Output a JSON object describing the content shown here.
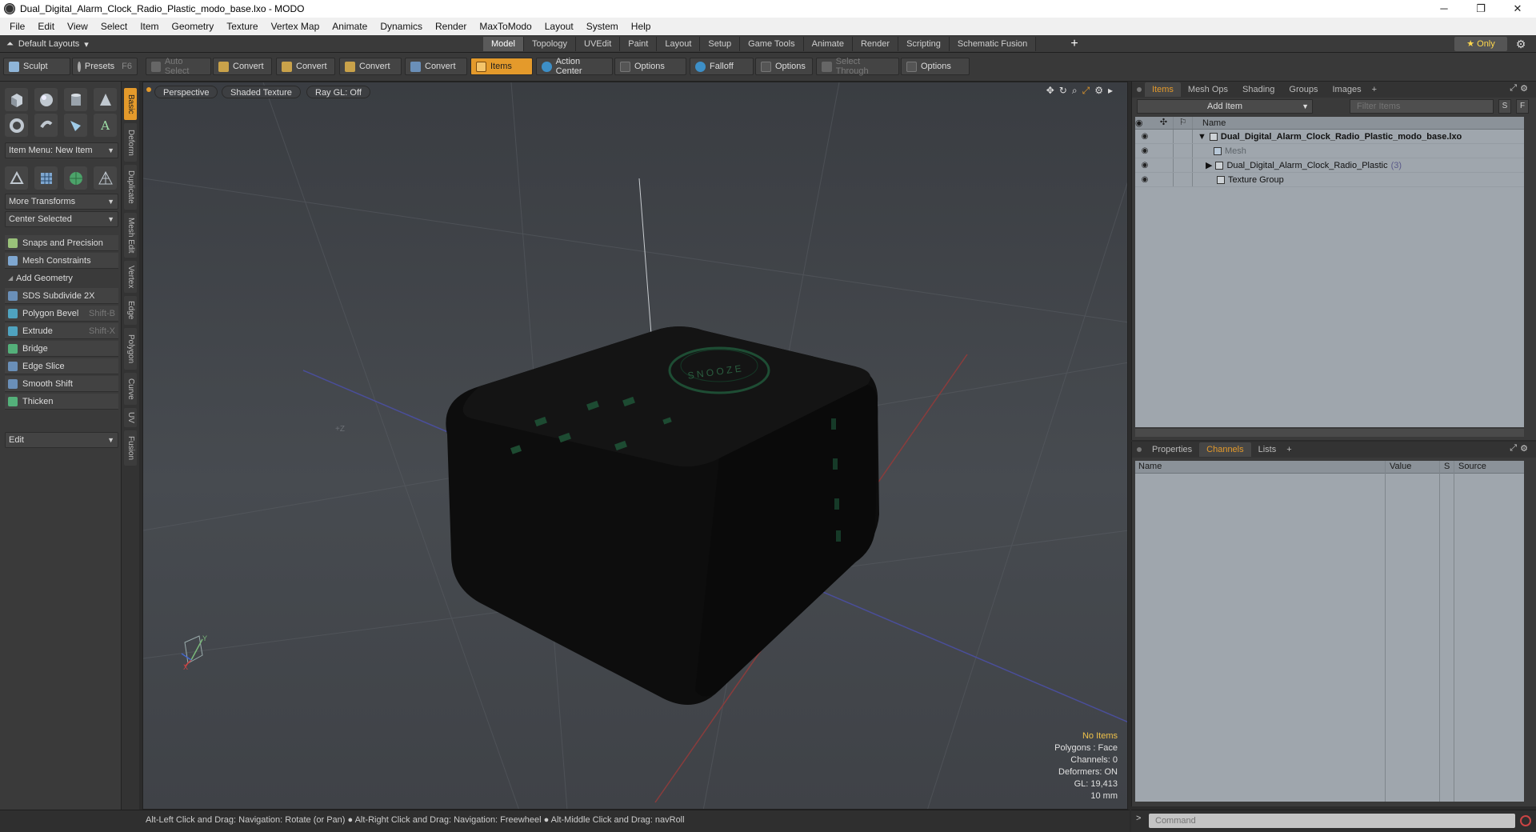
{
  "window": {
    "title": "Dual_Digital_Alarm_Clock_Radio_Plastic_modo_base.lxo - MODO",
    "controls": [
      "─",
      "❐",
      "✕"
    ]
  },
  "menu": [
    "File",
    "Edit",
    "View",
    "Select",
    "Item",
    "Geometry",
    "Texture",
    "Vertex Map",
    "Animate",
    "Dynamics",
    "Render",
    "MaxToModo",
    "Layout",
    "System",
    "Help"
  ],
  "layout_bar": {
    "layouts_label": "Default Layouts",
    "tabs": [
      "Model",
      "Topology",
      "UVEdit",
      "Paint",
      "Layout",
      "Setup",
      "Game Tools",
      "Animate",
      "Render",
      "Scripting",
      "Schematic Fusion"
    ],
    "active_tab": "Model",
    "add_label": "+",
    "only_label": "★  Only"
  },
  "toolbar": {
    "sculpt": "Sculpt",
    "presets": "Presets",
    "presets_key": "F6",
    "auto_select": "Auto Select",
    "convert1": "Convert",
    "convert2": "Convert",
    "convert3": "Convert",
    "convert4": "Convert",
    "items": "Items",
    "action_center": "Action Center",
    "options1": "Options",
    "falloff": "Falloff",
    "options2": "Options",
    "select_through": "Select Through",
    "options3": "Options"
  },
  "left_panel": {
    "item_menu": "Item Menu: New Item",
    "more_transforms": "More Transforms",
    "center_selected": "Center Selected",
    "snaps": "Snaps and Precision",
    "mesh_constraints": "Mesh Constraints",
    "add_geometry": "Add Geometry",
    "tools": [
      {
        "label": "SDS Subdivide 2X",
        "shortcut": "",
        "color": "#6a8fb8"
      },
      {
        "label": "Polygon Bevel",
        "shortcut": "Shift-B",
        "color": "#4fa3c0"
      },
      {
        "label": "Extrude",
        "shortcut": "Shift-X",
        "color": "#4fa3c0"
      },
      {
        "label": "Bridge",
        "shortcut": "",
        "color": "#54b07a"
      },
      {
        "label": "Edge Slice",
        "shortcut": "",
        "color": "#6a8fb8"
      },
      {
        "label": "Smooth Shift",
        "shortcut": "",
        "color": "#6a8fb8"
      },
      {
        "label": "Thicken",
        "shortcut": "",
        "color": "#54b07a"
      }
    ],
    "edit_drop": "Edit"
  },
  "vertical_tabs": [
    "Basic",
    "Deform",
    "Duplicate",
    "Mesh Edit",
    "Vertex",
    "Edge",
    "Polygon",
    "Curve",
    "UV",
    "Fusion"
  ],
  "viewport": {
    "view": "Perspective",
    "shading": "Shaded Texture",
    "raygl": "Ray GL: Off",
    "stats": {
      "no_items": "No Items",
      "polygons": "Polygons : Face",
      "channels": "Channels: 0",
      "deformers": "Deformers: ON",
      "gl": "GL: 19,413",
      "scale": "10 mm"
    },
    "axis_labels": {
      "y": "Y",
      "z": "+Z",
      "x": "X"
    }
  },
  "items_panel": {
    "tabs": [
      "Items",
      "Mesh Ops",
      "Shading",
      "Groups",
      "Images"
    ],
    "add_item": "Add Item",
    "filter_placeholder": "Filter Items",
    "s_btn": "S",
    "f_btn": "F",
    "col_name": "Name",
    "rows": [
      {
        "label": "Dual_Digital_Alarm_Clock_Radio_Plastic_modo_base.lxo",
        "count": ""
      },
      {
        "label": "Mesh",
        "count": ""
      },
      {
        "label": "Dual_Digital_Alarm_Clock_Radio_Plastic",
        "count": "(3)"
      },
      {
        "label": "Texture Group",
        "count": ""
      }
    ]
  },
  "channels_panel": {
    "tabs": [
      "Properties",
      "Channels",
      "Lists"
    ],
    "cols": {
      "name": "Name",
      "value": "Value",
      "s": "S",
      "source": "Source"
    }
  },
  "status": {
    "hint": "Alt-Left Click and Drag: Navigation: Rotate (or Pan) ● Alt-Right Click and Drag: Navigation: Freewheel ● Alt-Middle Click and Drag: navRoll",
    "command_placeholder": "Command"
  },
  "colors": {
    "accent": "#e49a2b",
    "viewport_bg": "#44474c",
    "tree_bg": "#9fa6ad"
  }
}
